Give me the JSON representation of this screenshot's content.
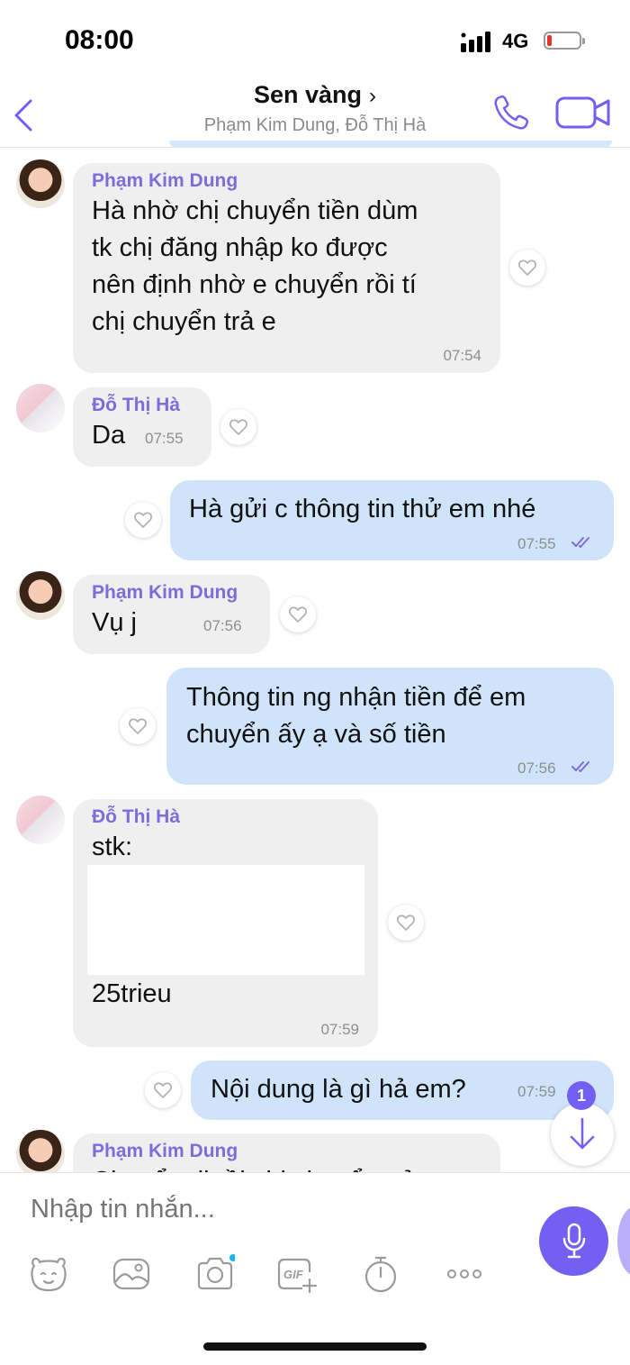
{
  "status_bar": {
    "time": "08:00",
    "network": "4G"
  },
  "header": {
    "title": "Sen vàng",
    "chevron": "›",
    "subtitle": "Phạm Kim Dung, Đỗ Thị Hà"
  },
  "messages": [
    {
      "sender": "Phạm Kim Dung",
      "lines": [
        "Hà nhờ chị chuyển tiền dùm",
        "tk chị đăng nhập ko được",
        "nên định nhờ e chuyển rồi tí",
        "chị chuyển trả e"
      ],
      "time": "07:54"
    },
    {
      "sender": "Đỗ Thị Hà",
      "lines": [
        "Da"
      ],
      "time": "07:55"
    },
    {
      "sender": "me",
      "lines": [
        "Hà gửi c thông tin thử em nhé"
      ],
      "time": "07:55"
    },
    {
      "sender": "Phạm Kim Dung",
      "lines": [
        "Vụ j"
      ],
      "time": "07:56"
    },
    {
      "sender": "me",
      "lines": [
        "Thông tin ng nhận tiền để em",
        "chuyển ấy ạ và số tiền"
      ],
      "time": "07:56"
    },
    {
      "sender": "Đỗ Thị Hà",
      "lines": [
        "stk:",
        "25trieu"
      ],
      "time": "07:59"
    },
    {
      "sender": "me",
      "lines": [
        "Nội dung là gì hả em?"
      ],
      "time": "07:59"
    },
    {
      "sender": "Phạm Kim Dung",
      "lines": [
        "Chuyển đi rồi chị chuyển trả"
      ],
      "time": ""
    }
  ],
  "scroll_badge": "1",
  "composer": {
    "placeholder": "Nhập tin nhắn..."
  },
  "toolbar_icons": [
    "sticker-icon",
    "gallery-icon",
    "camera-icon",
    "gif-icon",
    "timer-icon",
    "more-icon",
    "mic-icon"
  ],
  "colors": {
    "accent": "#7360f2",
    "sender_name": "#7d6cd9",
    "outgoing_bubble": "#cfe4fb",
    "incoming_bubble": "#efefef"
  }
}
